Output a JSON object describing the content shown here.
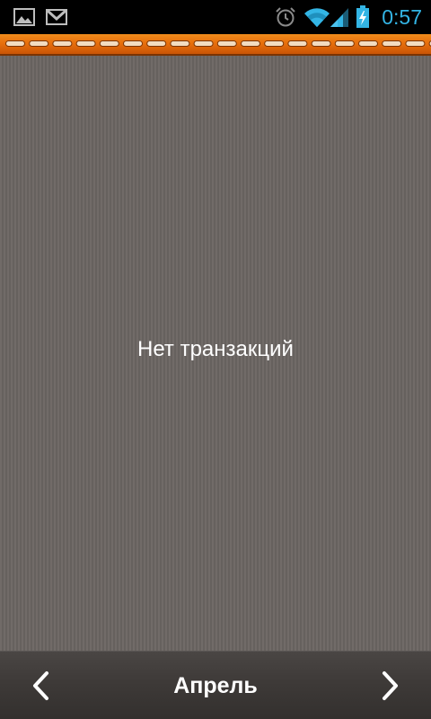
{
  "status_bar": {
    "time": "0:57",
    "icons": [
      "gallery-icon",
      "gmail-icon",
      "alarm-icon",
      "wifi-icon",
      "signal-icon",
      "battery-charging-icon"
    ],
    "accent_color": "#33b5e5"
  },
  "header": {
    "style": "orange leather stitched strip",
    "color": "#e8700c"
  },
  "content": {
    "empty_message": "Нет транзакций",
    "background_color": "#6c6663"
  },
  "bottom_nav": {
    "month": "Апрель",
    "prev_icon": "chevron-left-icon",
    "next_icon": "chevron-right-icon"
  }
}
